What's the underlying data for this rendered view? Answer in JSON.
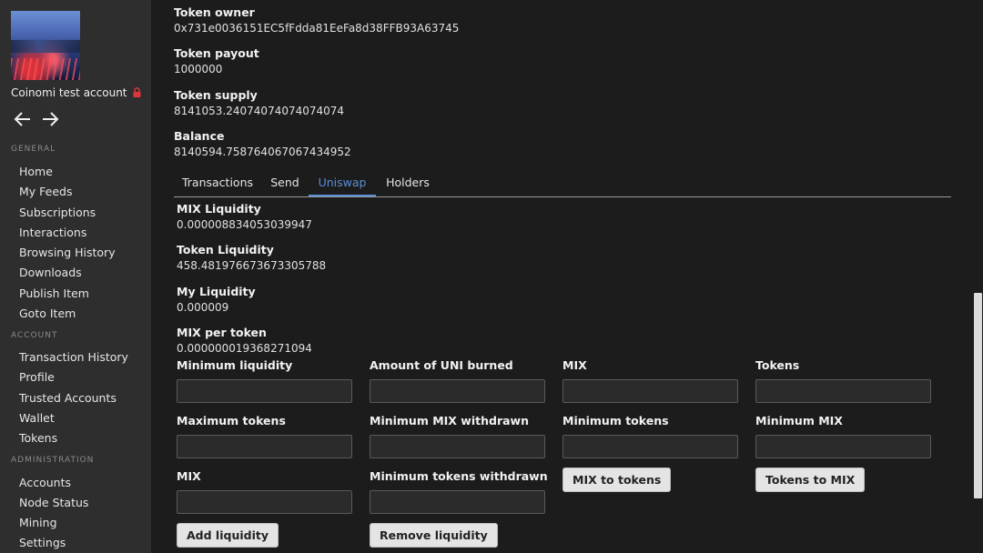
{
  "sidebar": {
    "account_name": "Coinomi test account",
    "sections": {
      "general": "GENERAL",
      "account": "ACCOUNT",
      "administration": "ADMINISTRATION"
    },
    "general_items": [
      "Home",
      "My Feeds",
      "Subscriptions",
      "Interactions",
      "Browsing History",
      "Downloads",
      "Publish Item",
      "Goto Item"
    ],
    "account_items": [
      "Transaction History",
      "Profile",
      "Trusted Accounts",
      "Wallet",
      "Tokens"
    ],
    "admin_items": [
      "Accounts",
      "Node Status",
      "Mining",
      "Settings"
    ]
  },
  "token": {
    "owner_label": "Token owner",
    "owner_value": "0x731e0036151EC5fFdda81EeFa8d38FFB93A63745",
    "payout_label": "Token payout",
    "payout_value": "1000000",
    "supply_label": "Token supply",
    "supply_value": "8141053.24074074074074074",
    "balance_label": "Balance",
    "balance_value": "8140594.758764067067434952"
  },
  "tabs": [
    "Transactions",
    "Send",
    "Uniswap",
    "Holders"
  ],
  "active_tab": "Uniswap",
  "uniswap": {
    "mix_liquidity_label": "MIX Liquidity",
    "mix_liquidity_value": "0.000008834053039947",
    "token_liquidity_label": "Token Liquidity",
    "token_liquidity_value": "458.481976673673305788",
    "my_liquidity_label": "My Liquidity",
    "my_liquidity_value": "0.000009",
    "mix_per_token_label": "MIX per token",
    "mix_per_token_value": "0.000000019368271094"
  },
  "forms": {
    "add": {
      "min_liquidity": "Minimum liquidity",
      "max_tokens": "Maximum tokens",
      "mix": "MIX",
      "button": "Add liquidity"
    },
    "remove": {
      "uni_burned": "Amount of UNI burned",
      "min_mix_withdrawn": "Minimum MIX withdrawn",
      "min_tokens_withdrawn": "Minimum tokens withdrawn",
      "button": "Remove liquidity"
    },
    "mix_to_tokens": {
      "mix": "MIX",
      "min_tokens": "Minimum tokens",
      "button": "MIX to tokens"
    },
    "tokens_to_mix": {
      "tokens": "Tokens",
      "min_mix": "Minimum MIX",
      "button": "Tokens to MIX"
    }
  },
  "colors": {
    "accent": "#5b8fd8",
    "lock": "#e0353b"
  }
}
